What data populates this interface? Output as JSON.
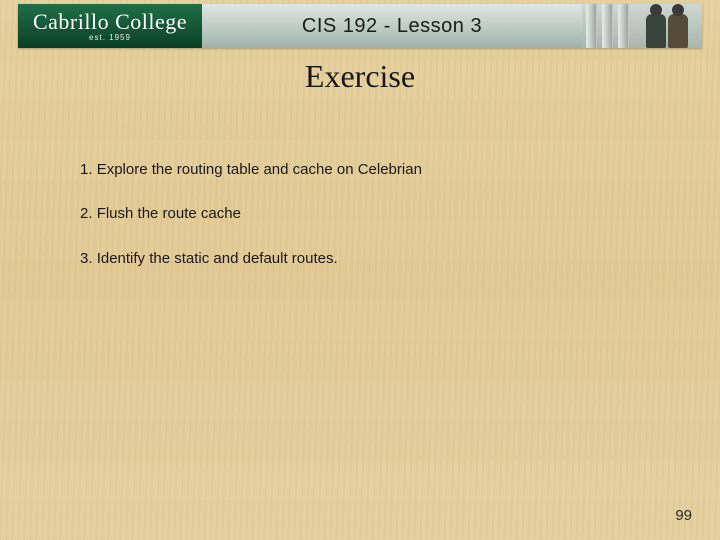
{
  "banner": {
    "logo_main": "Cabrillo College",
    "logo_sub": "est. 1959",
    "course_title": "CIS 192 - Lesson 3"
  },
  "slide": {
    "title": "Exercise",
    "items": [
      "Explore the routing table and cache on Celebrian",
      "Flush the route cache",
      "Identify the static and default routes."
    ],
    "page_number": "99"
  }
}
